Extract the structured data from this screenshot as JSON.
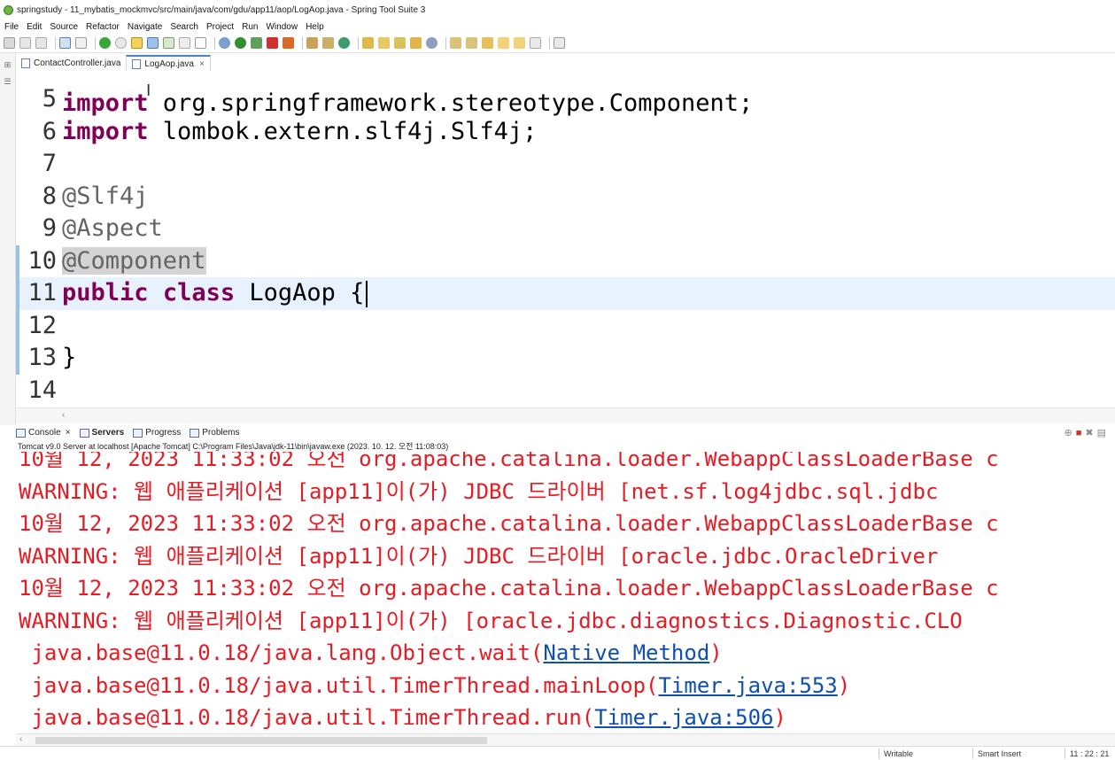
{
  "window": {
    "title": "springstudy - 11_mybatis_mockmvc/src/main/java/com/gdu/app11/aop/LogAop.java - Spring Tool Suite 3"
  },
  "menu": [
    "File",
    "Edit",
    "Source",
    "Refactor",
    "Navigate",
    "Search",
    "Project",
    "Run",
    "Window",
    "Help"
  ],
  "editor_tabs": [
    {
      "label": "ContactController.java",
      "active": false
    },
    {
      "label": "LogAop.java",
      "active": true,
      "close": "×"
    }
  ],
  "code": {
    "partial_top": "import org.springframework.stereotype.Component;",
    "lines": [
      {
        "num": "5",
        "segments": []
      },
      {
        "num": "6",
        "segments": [
          {
            "cls": "kw",
            "text": "import"
          },
          {
            "cls": "plain",
            "text": " lombok.extern.slf4j.Slf4j;"
          }
        ]
      },
      {
        "num": "7",
        "segments": []
      },
      {
        "num": "8",
        "segments": [
          {
            "cls": "ann",
            "text": "@Slf4j"
          }
        ]
      },
      {
        "num": "9",
        "segments": [
          {
            "cls": "ann",
            "text": "@Aspect"
          }
        ]
      },
      {
        "num": "10",
        "segments": [
          {
            "cls": "ann",
            "text": "@Component"
          }
        ]
      },
      {
        "num": "11",
        "segments": [
          {
            "cls": "kw",
            "text": "public"
          },
          {
            "cls": "plain",
            "text": " "
          },
          {
            "cls": "kw",
            "text": "class"
          },
          {
            "cls": "plain",
            "text": " LogAop {"
          }
        ]
      },
      {
        "num": "12",
        "segments": []
      },
      {
        "num": "13",
        "segments": [
          {
            "cls": "plain",
            "text": "}"
          }
        ]
      },
      {
        "num": "14",
        "segments": []
      }
    ]
  },
  "console_tabs": [
    {
      "label": "Console",
      "close": "×",
      "bold": false
    },
    {
      "label": "Servers",
      "bold": true
    },
    {
      "label": "Progress",
      "bold": false
    },
    {
      "label": "Problems",
      "bold": false
    }
  ],
  "console_process": "Tomcat v9.0 Server at localhost [Apache Tomcat] C:\\Program Files\\Java\\jdk-11\\bin\\javaw.exe  (2023. 10. 12. 오전 11:08:03)",
  "console_lines": [
    {
      "text": "10월 12, 2023 11:33:02 오전 org.apache.catalina.loader.WebappClassLoaderBase c"
    },
    {
      "text": "WARNING: 웹 애플리케이션 [app11]이(가) JDBC 드라이버 [net.sf.log4jdbc.sql.jdbc"
    },
    {
      "text": "10월 12, 2023 11:33:02 오전 org.apache.catalina.loader.WebappClassLoaderBase c"
    },
    {
      "text": "WARNING: 웹 애플리케이션 [app11]이(가) JDBC 드라이버 [oracle.jdbc.OracleDriver"
    },
    {
      "text": "10월 12, 2023 11:33:02 오전 org.apache.catalina.loader.WebappClassLoaderBase c"
    },
    {
      "text": "WARNING: 웹 애플리케이션 [app11]이(가) [oracle.jdbc.diagnostics.Diagnostic.CLO"
    },
    {
      "pre": " java.base@11.0.18/java.lang.Object.wait(",
      "link": "Native Method",
      "post": ")"
    },
    {
      "pre": " java.base@11.0.18/java.util.TimerThread.mainLoop(",
      "link": "Timer.java:553",
      "post": ")"
    },
    {
      "pre": " java.base@11.0.18/java.util.TimerThread.run(",
      "link": "Timer.java:506",
      "post": ")"
    }
  ],
  "statusbar": {
    "writable": "Writable",
    "insert_mode": "Smart Insert",
    "position": "11 : 22 : 21"
  },
  "colors": {
    "keyword": "#7f0055",
    "annotation": "#646464",
    "console_error": "#e51c23",
    "link": "#0f4fb0",
    "current_line": "#e8f2fe"
  }
}
